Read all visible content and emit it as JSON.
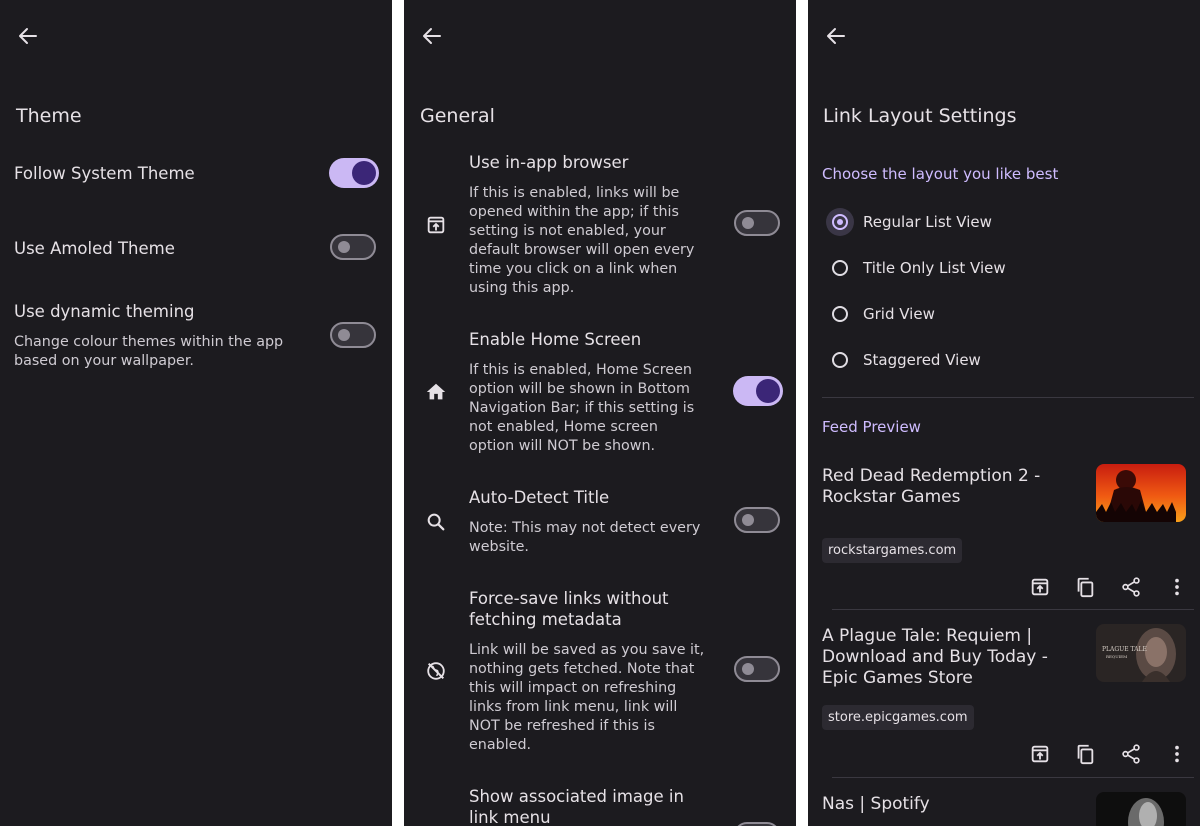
{
  "theme_screen": {
    "title": "Theme",
    "items": [
      {
        "label": "Follow System Theme",
        "enabled": true
      },
      {
        "label": "Use Amoled Theme",
        "enabled": false
      },
      {
        "label": "Use dynamic theming",
        "description": "Change colour themes within the app based on your wallpaper.",
        "enabled": false
      }
    ]
  },
  "general_screen": {
    "title": "General",
    "items": [
      {
        "label": "Use in-app browser",
        "description": "If this is enabled, links will be opened within the app; if this setting is not enabled, your default browser will open every time you click on a link when using this app.",
        "icon": "open-in-app-icon",
        "enabled": false
      },
      {
        "label": "Enable Home Screen",
        "description": "If this is enabled, Home Screen option will be shown in Bottom Navigation Bar; if this setting is not enabled, Home screen option will NOT be shown.",
        "icon": "home-icon",
        "enabled": true
      },
      {
        "label": "Auto-Detect Title",
        "description": "Note: This may not detect every website.",
        "icon": "search-icon",
        "enabled": false
      },
      {
        "label": "Force-save links without fetching metadata",
        "description": "Link will be saved as you save it, nothing gets fetched. Note that this will impact on refreshing links from link menu, link will NOT be refreshed if this is enabled.",
        "icon": "public-off-icon",
        "enabled": false
      },
      {
        "label": "Show associated image in link menu"
      }
    ]
  },
  "layout_screen": {
    "title": "Link Layout Settings",
    "choose_label": "Choose the layout you like best",
    "options": [
      {
        "label": "Regular List View",
        "selected": true
      },
      {
        "label": "Title Only List View",
        "selected": false
      },
      {
        "label": "Grid View",
        "selected": false
      },
      {
        "label": "Staggered View",
        "selected": false
      }
    ],
    "feed_preview_label": "Feed Preview",
    "feed": [
      {
        "title": "Red Dead Redemption 2 - Rockstar Games",
        "domain": "rockstargames.com"
      },
      {
        "title": "A Plague Tale: Requiem | Download and Buy Today - Epic Games Store",
        "domain": "store.epicgames.com",
        "thumb_text": "PLAGUE TALE REQUIEM"
      },
      {
        "title": "Nas | Spotify"
      }
    ]
  },
  "colors": {
    "background": "#1c1b1f",
    "accent": "#cfbcff",
    "toggle_on_track": "#cbb8f4",
    "toggle_on_thumb": "#3b2677"
  }
}
